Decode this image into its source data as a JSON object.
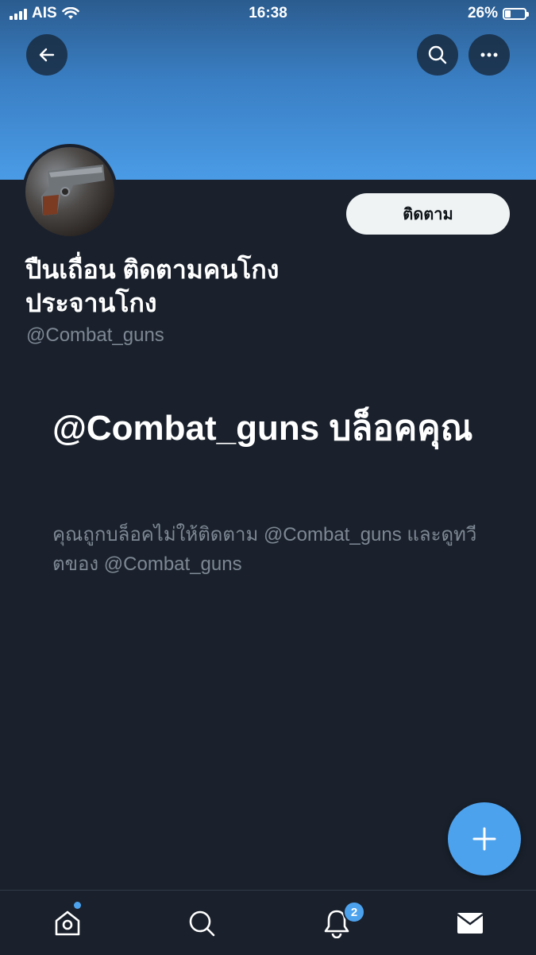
{
  "status_bar": {
    "carrier": "AIS",
    "time": "16:38",
    "battery_percent": "26%",
    "battery_level": 0.26
  },
  "profile": {
    "display_name": "ปืนเถื่อน ติดตามคนโกง ประจานโกง",
    "handle": "@Combat_guns",
    "follow_label": "ติดตาม"
  },
  "blocked": {
    "title": "@Combat_guns บล็อคคุณ",
    "description": "คุณถูกบล็อคไม่ให้ติดตาม @Combat_guns และดูทวีตของ @Combat_guns"
  },
  "nav": {
    "notifications_badge": "2",
    "icons": [
      "back-icon",
      "search-icon",
      "more-icon",
      "home-icon",
      "explore-icon",
      "notifications-icon",
      "messages-icon",
      "compose-icon"
    ]
  },
  "colors": {
    "background": "#1a212c",
    "accent": "#4da2ee",
    "muted_text": "#7d8894",
    "follow_button_bg": "#eff3f4"
  }
}
